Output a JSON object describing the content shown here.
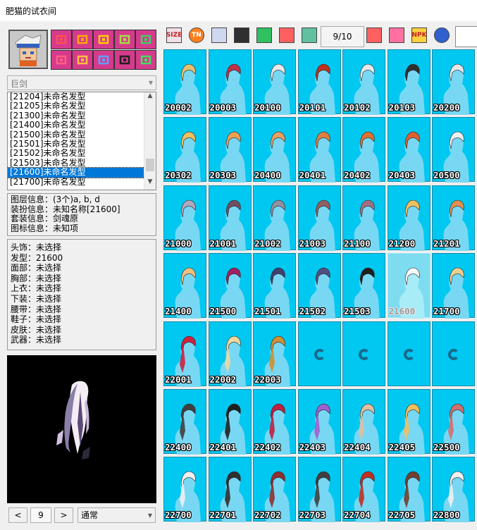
{
  "window": {
    "title": "肥猫的试衣间"
  },
  "sidebar": {
    "weapon_select": "巨剑",
    "category_icons": [
      "hat-icon",
      "hair-icon",
      "face-icon",
      "chest-icon",
      "top-icon",
      "bottom-icon",
      "belt-icon",
      "shoes-icon",
      "skin-icon",
      "weapon-icon"
    ],
    "list_items": [
      "[21204]未命名发型",
      "[21205]未命名发型",
      "[21300]未命名发型",
      "[21400]未命名发型",
      "[21500]未命名发型",
      "[21501]未命名发型",
      "[21502]未命名发型",
      "[21503]未命名发型",
      "[21600]未命名发型",
      "[21700]未命名发型"
    ],
    "selected_index": 8,
    "info": {
      "layer": "图层信息：(3个)a, b, d",
      "dress": "装扮信息：未知名称[21600]",
      "set": "套装信息：剑魂原",
      "icon": "图标信息：未知项"
    },
    "equip": [
      "头饰：未选择",
      "发型：21600",
      "面部：未选择",
      "胸部：未选择",
      "上衣：未选择",
      "下装：未选择",
      "腰带：未选择",
      "鞋子：未选择",
      "皮肤：未选择",
      "武器：未选择"
    ],
    "pager": {
      "prev": "<",
      "page": "9",
      "next": ">",
      "mode": "通常"
    }
  },
  "toolbar": {
    "buttons": [
      {
        "name": "size-icon",
        "label": "SIZE"
      },
      {
        "name": "tn-icon",
        "label": "TN"
      },
      {
        "name": "frame-icon",
        "label": ""
      },
      {
        "name": "film-icon",
        "label": ""
      },
      {
        "name": "shirt-icon",
        "label": ""
      },
      {
        "name": "clock-icon",
        "label": ""
      },
      {
        "name": "photo-icon",
        "label": ""
      }
    ],
    "page_indicator": "9/10",
    "right_buttons": [
      {
        "name": "export-icon",
        "label": ""
      },
      {
        "name": "gift-icon",
        "label": ""
      },
      {
        "name": "npk-icon",
        "label": "NPK"
      },
      {
        "name": "globe-icon",
        "label": ""
      }
    ]
  },
  "grid": {
    "codes": [
      "20002",
      "20003",
      "20100",
      "20101",
      "20102",
      "20103",
      "20200",
      "20302",
      "20303",
      "20400",
      "20401",
      "20402",
      "20403",
      "20500",
      "21000",
      "21001",
      "21002",
      "21003",
      "21100",
      "21200",
      "21201",
      "21400",
      "21500",
      "21501",
      "21502",
      "21503",
      "21600",
      "21700",
      "22001",
      "22002",
      "22003",
      "",
      "",
      "",
      "",
      "22400",
      "22401",
      "22402",
      "22403",
      "22404",
      "22405",
      "22500",
      "22700",
      "22701",
      "22702",
      "22703",
      "22704",
      "22705",
      "22800"
    ],
    "hair_colors": [
      "#e8c070",
      "#c03048",
      "#e8e8e8",
      "#c03020",
      "#e8e8e8",
      "#303030",
      "#e8e8e8",
      "#f0c060",
      "#f0a050",
      "#e8a060",
      "#e08040",
      "#e07030",
      "#e06030",
      "#f0f0f0",
      "#b0a8c0",
      "#705060",
      "#9090a0",
      "#906060",
      "#a07080",
      "#f0c060",
      "#e09050",
      "#f0c080",
      "#a02060",
      "#404070",
      "#505080",
      "#202020",
      "#f8f8f8",
      "#f0d090",
      "#d02040",
      "#f0d8a0",
      "#d09030",
      "",
      "",
      "",
      "",
      "#404040",
      "#202020",
      "#c02040",
      "#a060d0",
      "#e0c0a0",
      "#f0c060",
      "#d07070",
      "#f0f0f0",
      "#303030",
      "#903030",
      "#404040",
      "#c03020",
      "#704030",
      "#f0f0f0"
    ],
    "selected_code": "21600"
  }
}
